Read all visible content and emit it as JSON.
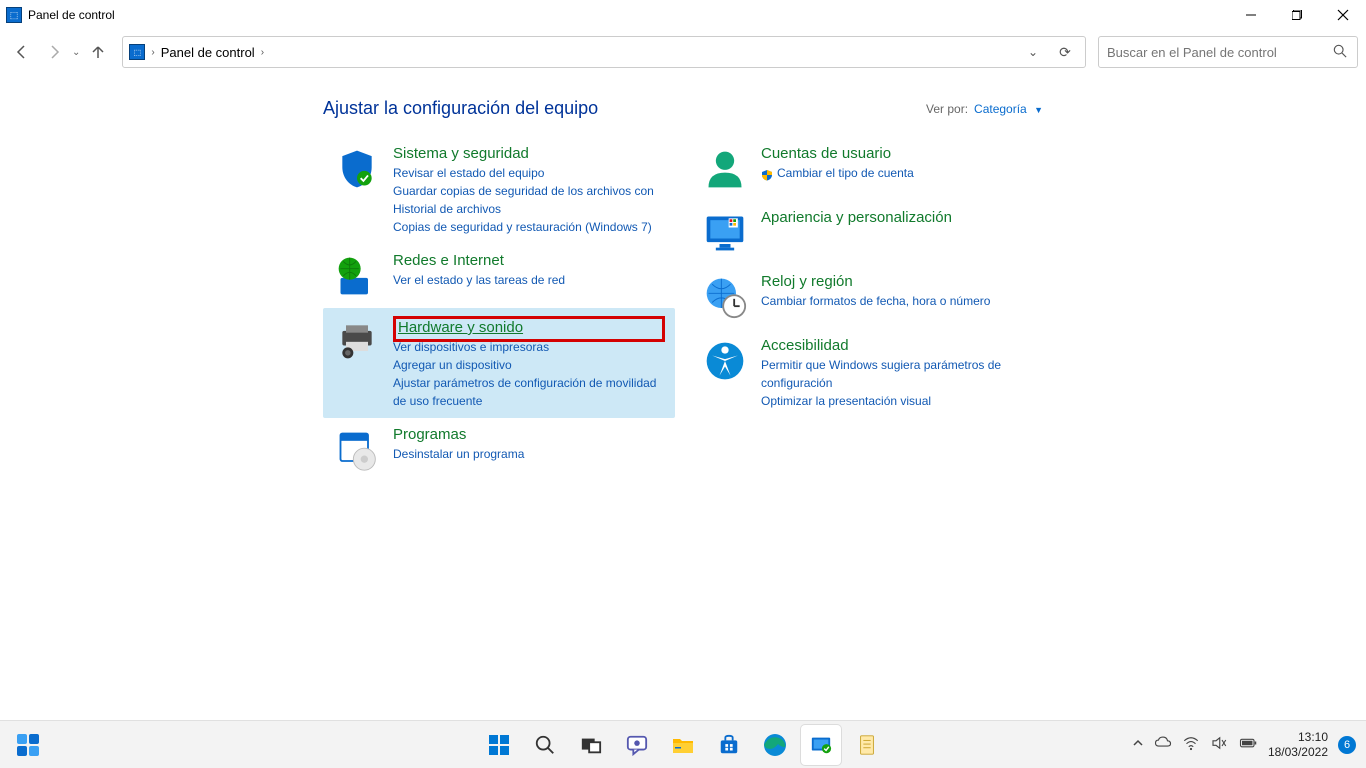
{
  "window": {
    "title": "Panel de control"
  },
  "navigation": {
    "breadcrumb": "Panel de control",
    "search_placeholder": "Buscar en el Panel de control"
  },
  "header": {
    "heading": "Ajustar la configuración del equipo",
    "view_by_label": "Ver por:",
    "view_by_value": "Categoría"
  },
  "categories": {
    "left": [
      {
        "title": "Sistema y seguridad",
        "links": [
          "Revisar el estado del equipo",
          "Guardar copias de seguridad de los archivos con Historial de archivos",
          "Copias de seguridad y restauración (Windows 7)"
        ]
      },
      {
        "title": "Redes e Internet",
        "links": [
          "Ver el estado y las tareas de red"
        ]
      },
      {
        "title": "Hardware y sonido",
        "links": [
          "Ver dispositivos e impresoras",
          "Agregar un dispositivo",
          "Ajustar parámetros de configuración de movilidad de uso frecuente"
        ]
      },
      {
        "title": "Programas",
        "links": [
          "Desinstalar un programa"
        ]
      }
    ],
    "right": [
      {
        "title": "Cuentas de usuario",
        "links": [
          "Cambiar el tipo de cuenta"
        ]
      },
      {
        "title": "Apariencia y personalización",
        "links": []
      },
      {
        "title": "Reloj y región",
        "links": [
          "Cambiar formatos de fecha, hora o número"
        ]
      },
      {
        "title": "Accesibilidad",
        "links": [
          "Permitir que Windows sugiera parámetros de configuración",
          "Optimizar la presentación visual"
        ]
      }
    ]
  },
  "taskbar": {
    "time": "13:10",
    "date": "18/03/2022",
    "badge": "6"
  }
}
